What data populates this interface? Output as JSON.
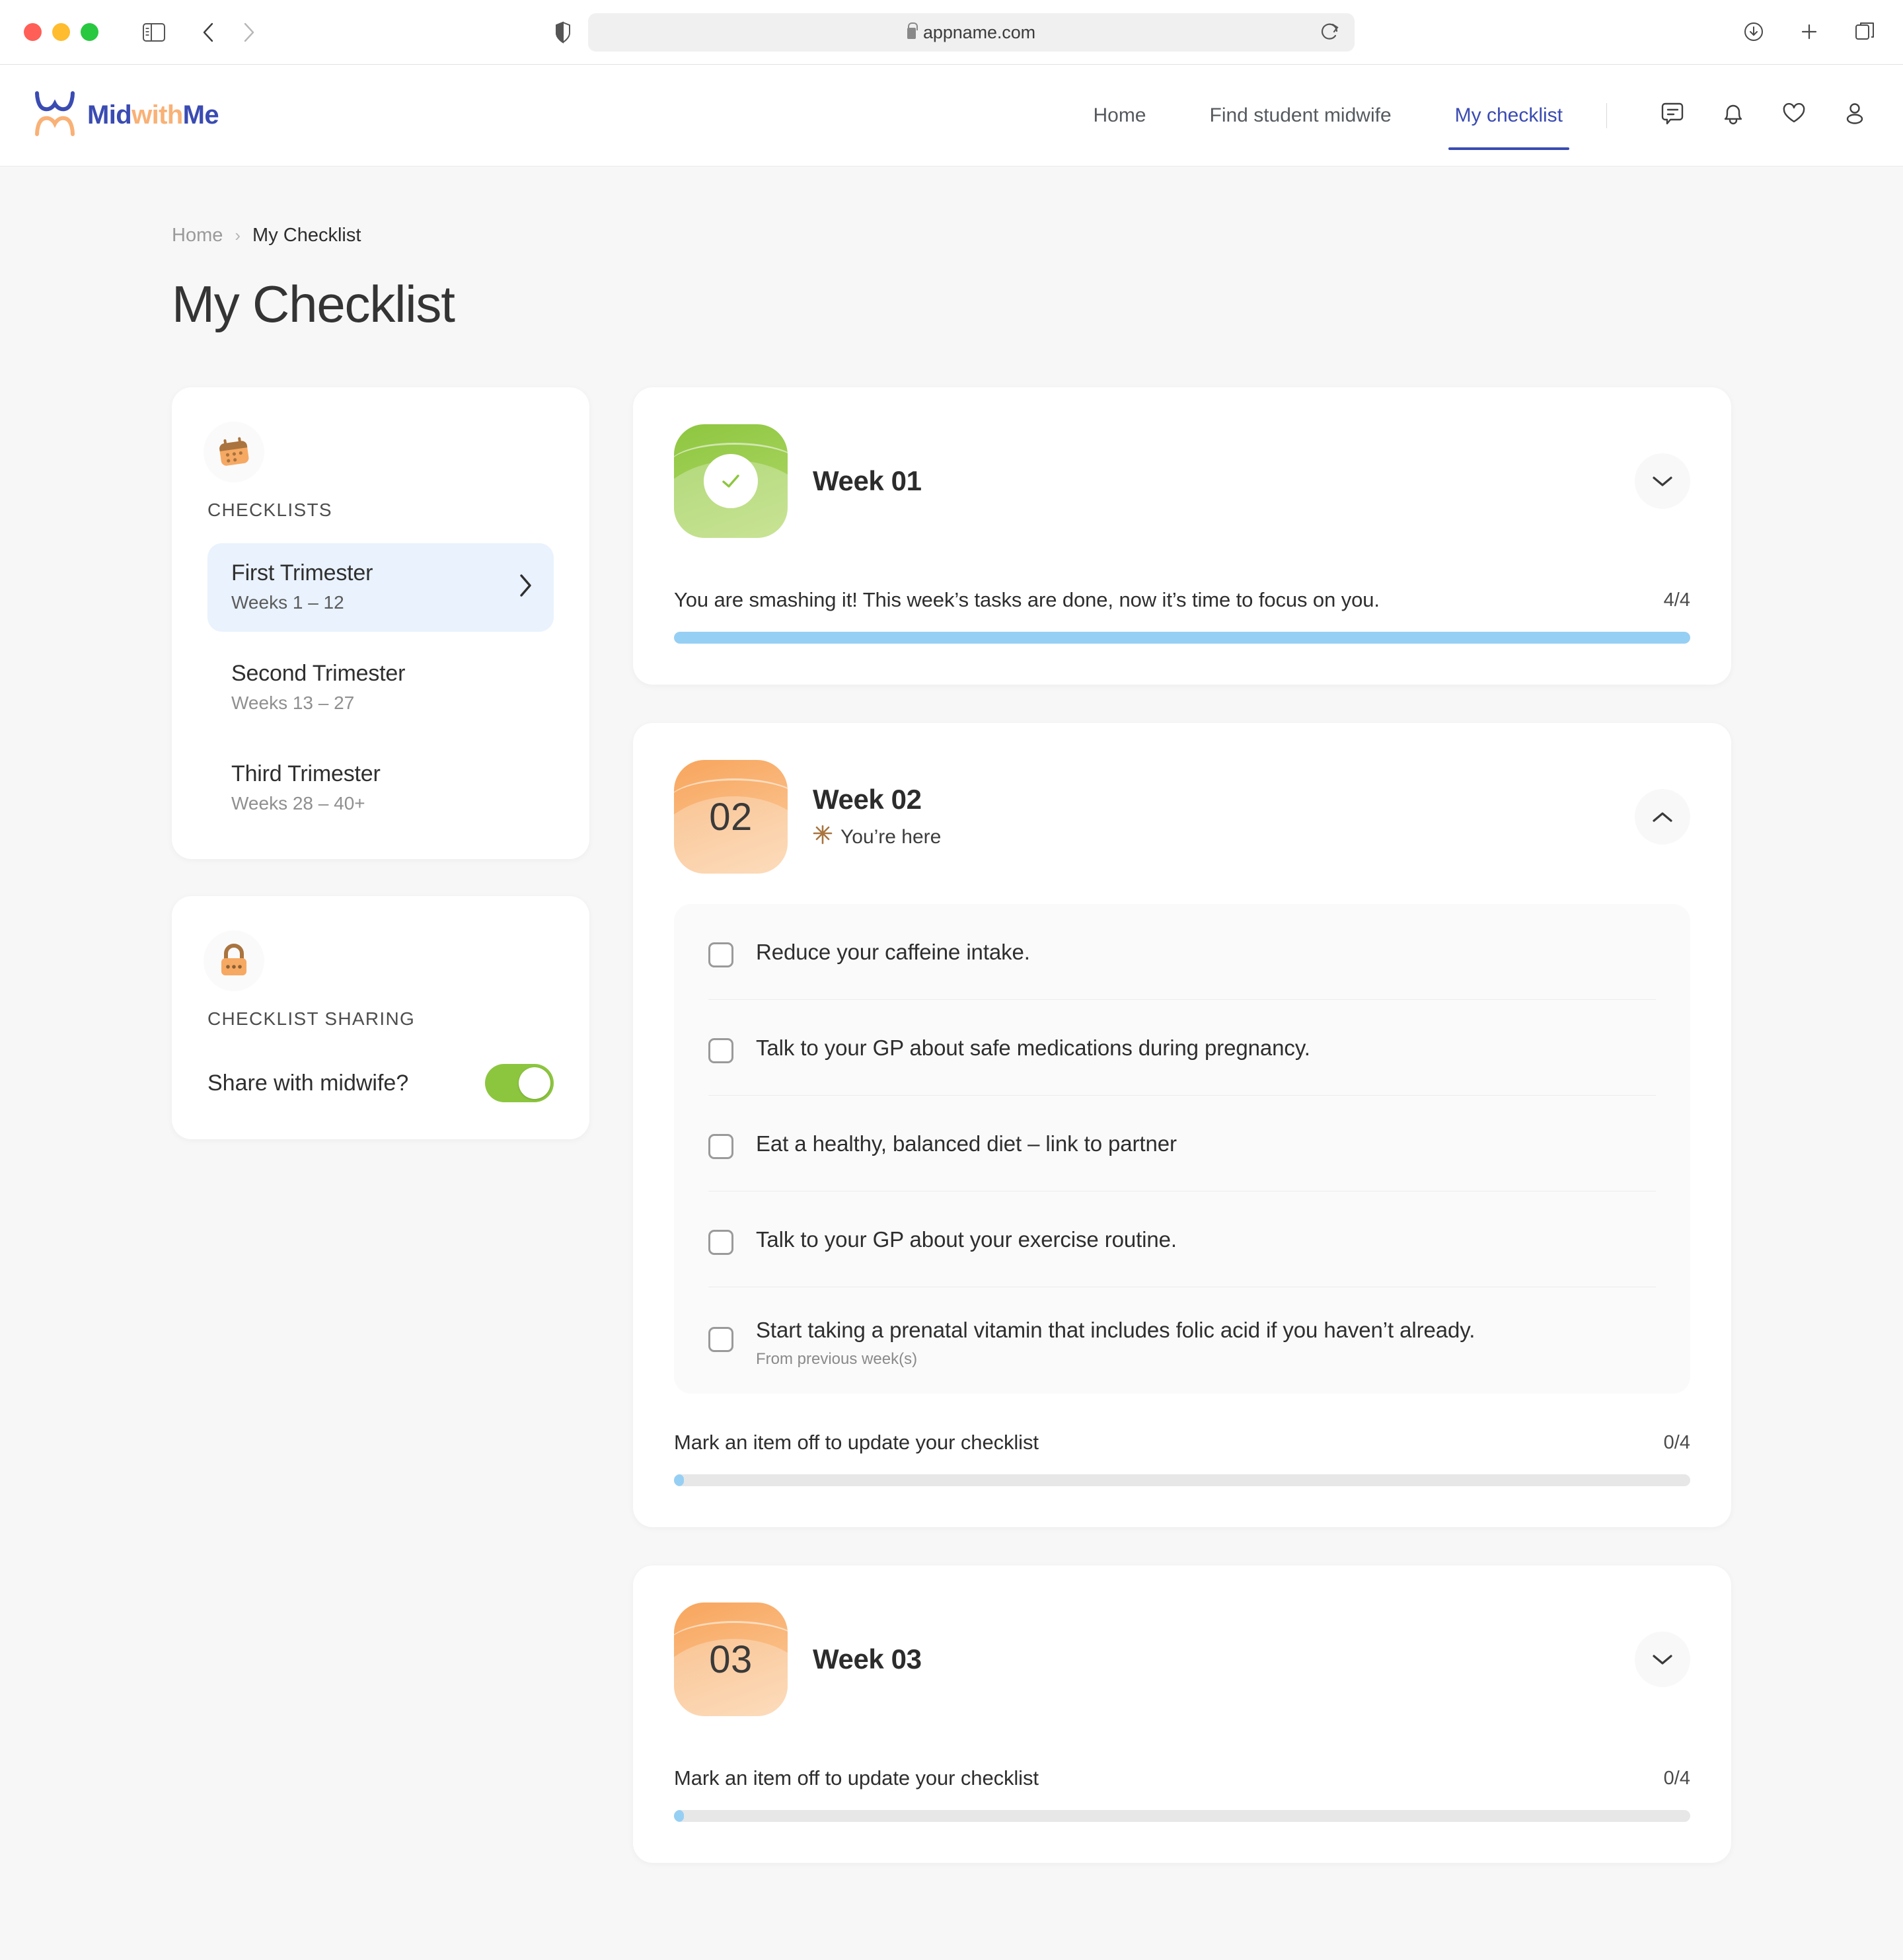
{
  "browser": {
    "url": "appname.com",
    "lock_icon": "lock-icon",
    "shield_icon": "shield-icon",
    "reload_icon": "reload-icon",
    "back_icon": "chevron-left-icon",
    "forward_icon": "chevron-right-icon",
    "sidebar_icon": "sidebar-toggle-icon",
    "download_icon": "download-icon",
    "new_tab_icon": "plus-icon",
    "tabs_icon": "tab-overview-icon"
  },
  "header": {
    "logo": {
      "part1": "Mid",
      "part2": "with",
      "part3": "Me",
      "icon": "butterfly-logo-icon"
    },
    "nav": [
      {
        "label": "Home",
        "active": false
      },
      {
        "label": "Find student midwife",
        "active": false
      },
      {
        "label": "My checklist",
        "active": true
      }
    ],
    "icons": [
      {
        "name": "messages-icon"
      },
      {
        "name": "notifications-bell-icon"
      },
      {
        "name": "favourites-heart-icon"
      },
      {
        "name": "account-person-icon"
      }
    ]
  },
  "breadcrumb": {
    "home": "Home",
    "separator": "›",
    "current": "My Checklist"
  },
  "page_title": "My Checklist",
  "sidebar": {
    "checklists": {
      "icon": "calendar-icon",
      "label": "CHECKLISTS",
      "items": [
        {
          "name": "First Trimester",
          "weeks": "Weeks 1 – 12",
          "active": true,
          "chevron": "chevron-right-icon"
        },
        {
          "name": "Second Trimester",
          "weeks": "Weeks 13 – 27",
          "active": false
        },
        {
          "name": "Third Trimester",
          "weeks": "Weeks 28 – 40+",
          "active": false
        }
      ]
    },
    "sharing": {
      "icon": "padlock-icon",
      "label": "CHECKLIST SHARING",
      "toggle_label": "Share with midwife?",
      "toggle_on": true,
      "toggle_color": "#8cc63f"
    }
  },
  "weeks": [
    {
      "number": "01",
      "title": "Week 01",
      "badge_style": "green-complete",
      "badge_icon": "check-circle-icon",
      "collapsed": true,
      "chevron": "chevron-down-icon",
      "message": "You are smashing it! This week’s tasks are done, now it’s time to focus on you.",
      "count": "4/4",
      "progress_percent": 100
    },
    {
      "number": "02",
      "title": "Week 02",
      "badge_style": "orange",
      "status_icon": "sparkle-icon",
      "status_label": "You’re here",
      "collapsed": false,
      "chevron": "chevron-up-icon",
      "items": [
        {
          "text": "Reduce your caffeine intake.",
          "checked": false,
          "sub": ""
        },
        {
          "text": "Talk to your GP about safe medications during pregnancy.",
          "checked": false,
          "sub": ""
        },
        {
          "text": "Eat a healthy, balanced diet – link to partner",
          "checked": false,
          "sub": ""
        },
        {
          "text": "Talk to your GP about your exercise routine.",
          "checked": false,
          "sub": ""
        },
        {
          "text": "Start taking a prenatal vitamin that includes folic acid if you haven’t already.",
          "checked": false,
          "sub": "From previous week(s)"
        }
      ],
      "message": "Mark an item off to update your checklist",
      "count": "0/4",
      "progress_percent": 1
    },
    {
      "number": "03",
      "title": "Week 03",
      "badge_style": "orange",
      "collapsed": true,
      "chevron": "chevron-down-icon",
      "message": "Mark an item off to update your checklist",
      "count": "0/4",
      "progress_percent": 1
    }
  ],
  "colors": {
    "brand_blue": "#3a4bb2",
    "brand_orange": "#f9b176",
    "progress_blue": "#96cff4",
    "toggle_green": "#8cc63f",
    "active_item_bg": "#e9f2fd"
  }
}
